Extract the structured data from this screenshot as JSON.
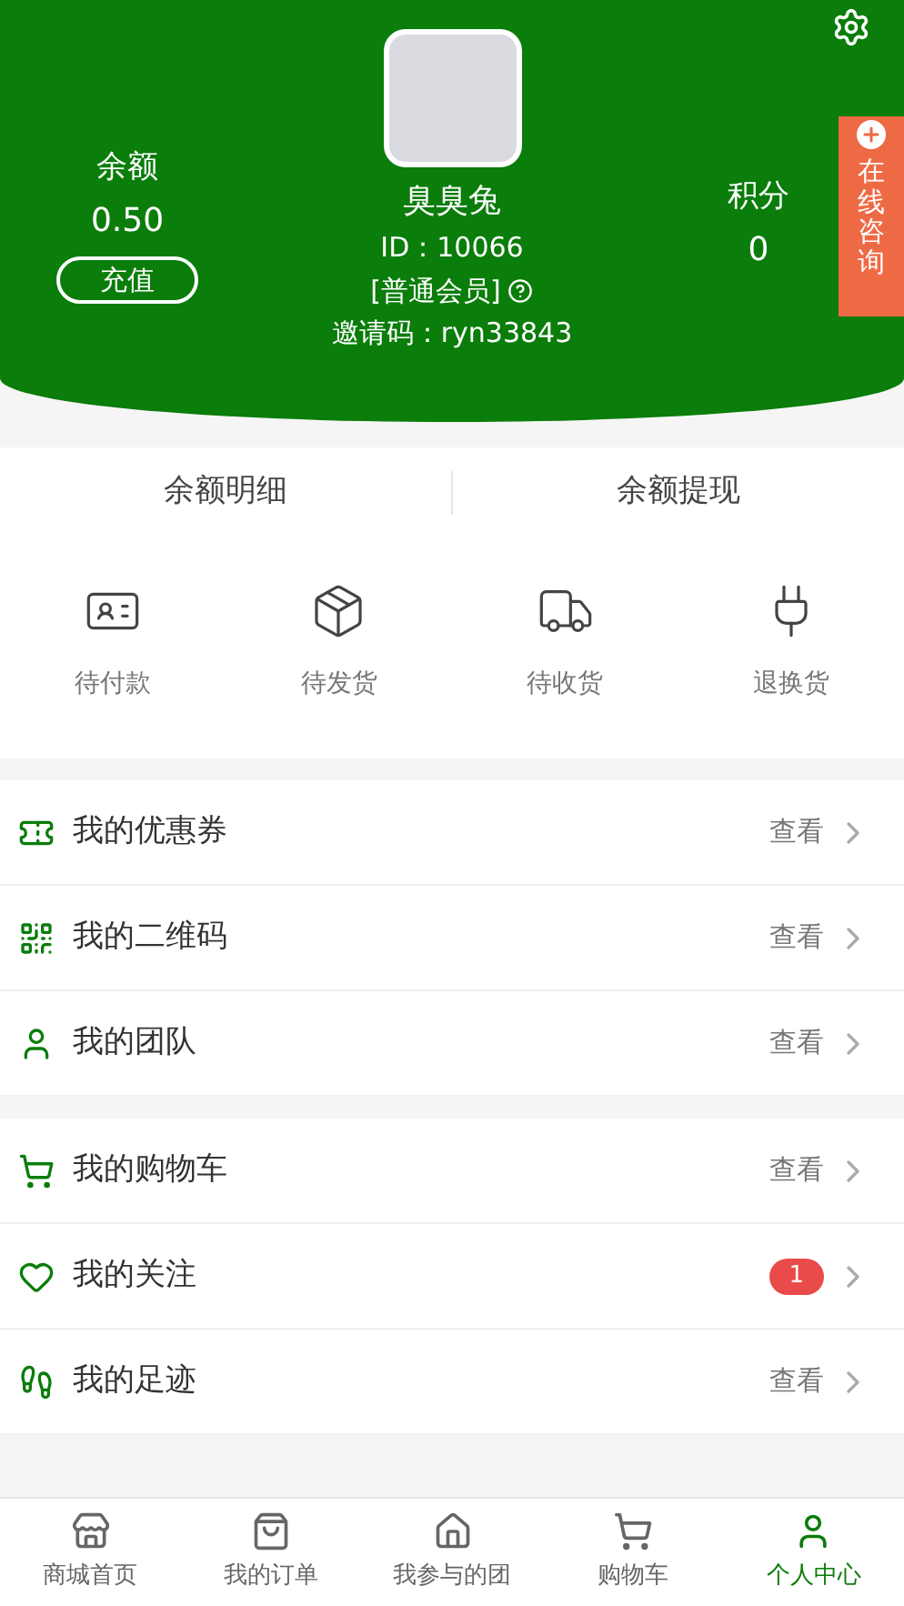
{
  "header": {
    "balance_label": "余额",
    "balance": "0.50",
    "recharge": "充值",
    "username": "臭臭兔",
    "user_id": "ID：10066",
    "member_level": "[普通会员]",
    "invite_code": "邀请码：ryn33843",
    "points_label": "积分",
    "points": "0",
    "consult": "在线咨询"
  },
  "balance_links": [
    "余额明细",
    "余额提现"
  ],
  "order_status": [
    {
      "kind": "payment",
      "label": "待付款"
    },
    {
      "kind": "shipping",
      "label": "待发货"
    },
    {
      "kind": "receiving",
      "label": "待收货"
    },
    {
      "kind": "return",
      "label": "退换货"
    }
  ],
  "menu_groups": [
    [
      {
        "kind": "coupon",
        "label": "我的优惠券",
        "action": "查看"
      },
      {
        "kind": "qrcode",
        "label": "我的二维码",
        "action": "查看"
      },
      {
        "kind": "team",
        "label": "我的团队",
        "action": "查看"
      }
    ],
    [
      {
        "kind": "cart",
        "label": "我的购物车",
        "action": "查看"
      },
      {
        "kind": "heart",
        "label": "我的关注",
        "badge": "1"
      },
      {
        "kind": "footprint",
        "label": "我的足迹",
        "action": "查看"
      }
    ]
  ],
  "tab_bar": [
    {
      "kind": "store",
      "label": "商城首页",
      "selected": false
    },
    {
      "kind": "bag",
      "label": "我的订单",
      "selected": false
    },
    {
      "kind": "home",
      "label": "我参与的团",
      "selected": false
    },
    {
      "kind": "cart",
      "label": "购物车",
      "selected": false
    },
    {
      "kind": "user",
      "label": "个人中心",
      "selected": true
    }
  ]
}
